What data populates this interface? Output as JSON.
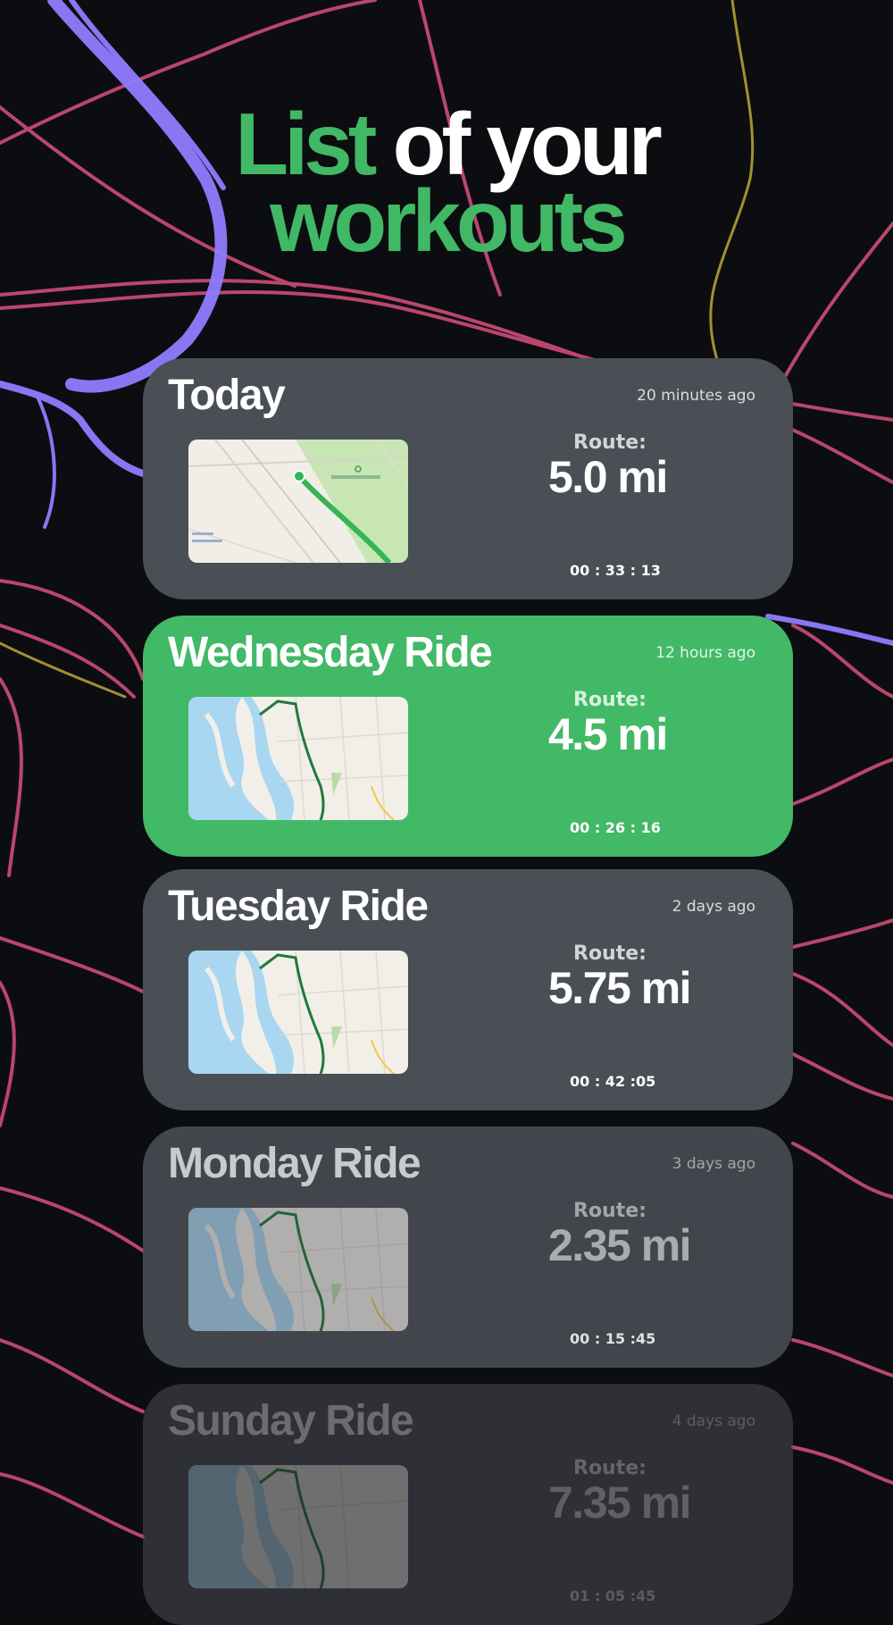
{
  "header": {
    "title_accent": "List",
    "title_rest": " of your",
    "title_line2": "workouts"
  },
  "colors": {
    "accent": "#41b865",
    "card": "#4a4e55",
    "background": "#0c0d10"
  },
  "workouts": [
    {
      "name": "Today",
      "ago": "20 minutes ago",
      "route_label": "Route:",
      "distance": "5.0 mi",
      "duration": "00 : 33 : 13",
      "map": "park-map-thumbnail"
    },
    {
      "name": "Wednesday Ride",
      "ago": "12 hours ago",
      "route_label": "Route:",
      "distance": "4.5 mi",
      "duration": "00 : 26 : 16",
      "map": "river-map-thumbnail"
    },
    {
      "name": "Tuesday Ride",
      "ago": "2 days ago",
      "route_label": "Route:",
      "distance": "5.75 mi",
      "duration": "00 : 42 :05",
      "map": "river-map-thumbnail"
    },
    {
      "name": "Monday Ride",
      "ago": "3 days ago",
      "route_label": "Route:",
      "distance": "2.35 mi",
      "duration": "00 : 15 :45",
      "map": "river-map-thumbnail"
    },
    {
      "name": "Sunday Ride",
      "ago": "4 days ago",
      "route_label": "Route:",
      "distance": "7.35 mi",
      "duration": "01 : 05 :45",
      "map": "river-map-thumbnail"
    }
  ]
}
